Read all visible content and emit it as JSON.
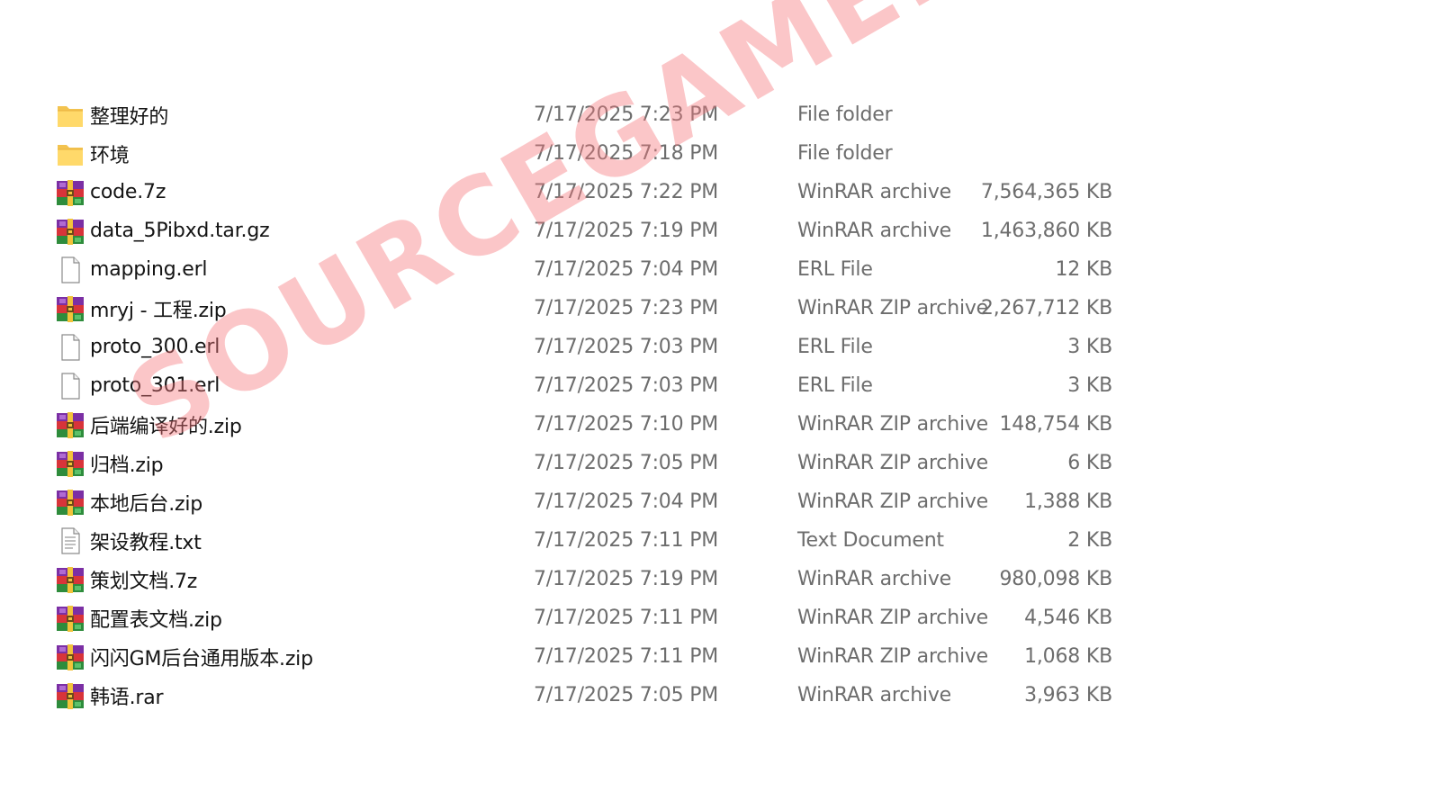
{
  "watermark": "SOURCEGAME.VN",
  "files": [
    {
      "name": "整理好的",
      "date": "7/17/2025 7:23 PM",
      "type": "File folder",
      "size": "",
      "icon": "folder-icon"
    },
    {
      "name": "环境",
      "date": "7/17/2025 7:18 PM",
      "type": "File folder",
      "size": "",
      "icon": "folder-icon"
    },
    {
      "name": "code.7z",
      "date": "7/17/2025 7:22 PM",
      "type": "WinRAR archive",
      "size": "7,564,365 KB",
      "icon": "winrar-archive-icon"
    },
    {
      "name": "data_5Pibxd.tar.gz",
      "date": "7/17/2025 7:19 PM",
      "type": "WinRAR archive",
      "size": "1,463,860 KB",
      "icon": "winrar-archive-icon"
    },
    {
      "name": "mapping.erl",
      "date": "7/17/2025 7:04 PM",
      "type": "ERL File",
      "size": "12 KB",
      "icon": "blank-file-icon"
    },
    {
      "name": "mryj - 工程.zip",
      "date": "7/17/2025 7:23 PM",
      "type": "WinRAR ZIP archive",
      "size": "2,267,712 KB",
      "icon": "winrar-archive-icon"
    },
    {
      "name": "proto_300.erl",
      "date": "7/17/2025 7:03 PM",
      "type": "ERL File",
      "size": "3 KB",
      "icon": "blank-file-icon"
    },
    {
      "name": "proto_301.erl",
      "date": "7/17/2025 7:03 PM",
      "type": "ERL File",
      "size": "3 KB",
      "icon": "blank-file-icon"
    },
    {
      "name": "后端编译好的.zip",
      "date": "7/17/2025 7:10 PM",
      "type": "WinRAR ZIP archive",
      "size": "148,754 KB",
      "icon": "winrar-archive-icon"
    },
    {
      "name": "归档.zip",
      "date": "7/17/2025 7:05 PM",
      "type": "WinRAR ZIP archive",
      "size": "6 KB",
      "icon": "winrar-archive-icon"
    },
    {
      "name": "本地后台.zip",
      "date": "7/17/2025 7:04 PM",
      "type": "WinRAR ZIP archive",
      "size": "1,388 KB",
      "icon": "winrar-archive-icon"
    },
    {
      "name": "架设教程.txt",
      "date": "7/17/2025 7:11 PM",
      "type": "Text Document",
      "size": "2 KB",
      "icon": "text-file-icon"
    },
    {
      "name": "策划文档.7z",
      "date": "7/17/2025 7:19 PM",
      "type": "WinRAR archive",
      "size": "980,098 KB",
      "icon": "winrar-archive-icon"
    },
    {
      "name": "配置表文档.zip",
      "date": "7/17/2025 7:11 PM",
      "type": "WinRAR ZIP archive",
      "size": "4,546 KB",
      "icon": "winrar-archive-icon"
    },
    {
      "name": "闪闪GM后台通用版本.zip",
      "date": "7/17/2025 7:11 PM",
      "type": "WinRAR ZIP archive",
      "size": "1,068 KB",
      "icon": "winrar-archive-icon"
    },
    {
      "name": "韩语.rar",
      "date": "7/17/2025 7:05 PM",
      "type": "WinRAR archive",
      "size": "3,963 KB",
      "icon": "winrar-archive-icon"
    }
  ]
}
